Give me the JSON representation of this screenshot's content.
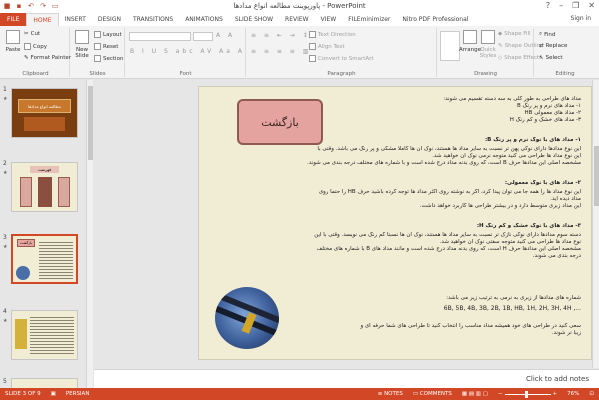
{
  "window": {
    "title": "پاورپوینت مطالعه انواع مدادها - PowerPoint",
    "controls": [
      "?",
      "–",
      "❐",
      "✕"
    ],
    "signin": "Sign in"
  },
  "tabs": [
    "FILE",
    "HOME",
    "INSERT",
    "DESIGN",
    "TRANSITIONS",
    "ANIMATIONS",
    "SLIDE SHOW",
    "REVIEW",
    "VIEW",
    "FILEminimizer",
    "Nitro PDF Professional"
  ],
  "ribbon": {
    "clipboard": {
      "paste": "Paste",
      "cut": "Cut",
      "copy": "Copy",
      "format_painter": "Format Painter",
      "label": "Clipboard"
    },
    "slides": {
      "new_slide": "New Slide",
      "layout": "Layout",
      "reset": "Reset",
      "section": "Section",
      "label": "Slides"
    },
    "font": {
      "label": "Font"
    },
    "paragraph": {
      "text_direction": "Text Direction",
      "align_text": "Align Text",
      "smartart": "Convert to SmartArt",
      "label": "Paragraph"
    },
    "drawing": {
      "arrange": "Arrange",
      "quick_styles": "Quick Styles",
      "shape_fill": "Shape Fill",
      "shape_outline": "Shape Outline",
      "shape_effects": "Shape Effects",
      "label": "Drawing"
    },
    "editing": {
      "find": "Find",
      "replace": "Replace",
      "select": "Select",
      "label": "Editing"
    }
  },
  "thumbnails": [
    {
      "num": "1",
      "title": "مطالعه انواع مدادها"
    },
    {
      "num": "2",
      "title": "فهرست"
    },
    {
      "num": "3",
      "title": "بازگشت"
    },
    {
      "num": "4",
      "title": ""
    },
    {
      "num": "5",
      "title": ""
    }
  ],
  "slide": {
    "back_button": "بازگشت",
    "intro": [
      "مداد های طراحی به طور کلی به سه دسته تقسیم می شوند:",
      "۱- مداد های نرم و پر رنگ B",
      "۲- مداد های معمولی HB",
      "۳- مداد های خشک و کم رنگ H"
    ],
    "sections": [
      {
        "heading": "۱- مداد های با نوک نرم و پر رنگ B:",
        "lines": [
          "این نوع مدادها دارای نوکی پهن تر نسبت به سایر مداد ها هستند، نوک آن ها کاملا مشکی و پر رنگ می باشد. وقتی با",
          "این نوع مداد ها طراحی می کنید متوجه نرمی نوک آن خواهید شد.",
          "مشخصه اصلی این مدادها حرف B است، که روی بدنه مداد درج شده است و با شماره های مختلف درجه بندی می شوند."
        ]
      },
      {
        "heading": "۲- مداد های با نوک معمولی:",
        "lines": [
          "این نوع مداد ها را همه جا می توان پیدا کرد، اگر به نوشته روی اکثر مداد ها توجه کرده باشید حرف HB را حتما روی",
          "مداد دیده اید.",
          "این مداد زبری متوسط دارد و در بیشتر طراحی ها کاربرد خواهد داشت."
        ]
      },
      {
        "heading": "۳- مداد های با نوک خشک و کم رنگ H:",
        "lines": [
          "دسته سوم مدادها دارای نوکی نازک تر نسبت به سایر مداد ها هستند، نوک آن ها نسبتاً کم رنگ می نویسد. وقتی با این",
          "نوع مداد ها طراحی می کنید متوجه سفتی نوک آن خواهید شد.",
          "مشخصه اصلی این مدادها حرف H است، که روی بدنه مداد درج شده است و مانند مداد های B با شماره های مختلف",
          "درجه بندی می شوند."
        ]
      }
    ],
    "order_intro": "شماره های مدادها از زبری به نرمی به ترتیب زیر می باشد:",
    "order_list": "6B, 5B, 4B, 3B, 2B, 1B, HB, 1H, 2H, 3H, 4H ,...",
    "closing": [
      "سعی کنید در طراحی های خود همیشه مداد مناسب را انتخاب کنید تا طراحی های شما حرفه ای و",
      "زیبا تر شوند."
    ]
  },
  "notes_placeholder": "Click to add notes",
  "status": {
    "slide": "SLIDE 3 OF 9",
    "language": "PERSIAN",
    "notes": "NOTES",
    "comments": "COMMENTS",
    "zoom": "76%"
  }
}
